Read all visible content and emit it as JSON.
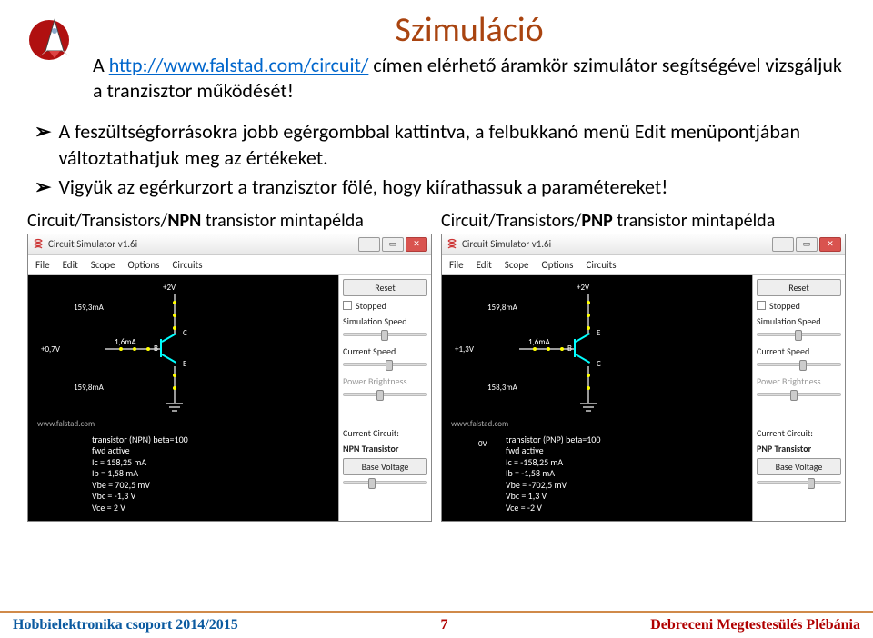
{
  "title": "Szimuláció",
  "intro_prefix": "A ",
  "intro_link": "http://www.falstad.com/circuit/",
  "intro_suffix": " címen elérhető áramkör szimulátor segítségével vizsgáljuk a tranzisztor működését!",
  "bullets": [
    "A feszültségforrásokra jobb egérgombbal kattintva, a felbukkanó menü Edit menüpontjában változtathatjuk meg az értékeket.",
    "Vigyük az egérkurzort a tranzisztor fölé, hogy kiírathassuk a paramétereket!"
  ],
  "sims": [
    {
      "caption_pre": "Circuit/Transistors/",
      "caption_bold": "NPN",
      "caption_post": " transistor mintapélda",
      "window_title": "Circuit Simulator v1.6i",
      "menu": [
        "File",
        "Edit",
        "Scope",
        "Options",
        "Circuits"
      ],
      "labels": {
        "top": "+2V",
        "left": "+0,7V",
        "i1": "159,3mA",
        "i2": "1,6mA",
        "i3": "159,8mA",
        "B": "B",
        "C": "C",
        "E": "E",
        "gnd": ""
      },
      "footer_url": "www.falstad.com",
      "text": [
        "transistor (NPN) beta=100",
        "fwd active",
        "Ic = 158,25 mA",
        "Ib = 1,58 mA",
        "Vbe = 702,5 mV",
        "Vbc = -1,3 V",
        "Vce = 2 V"
      ],
      "side": {
        "reset": "Reset",
        "stopped": "Stopped",
        "simspeed": "Simulation Speed",
        "curspeed": "Current Speed",
        "powerbright": "Power Brightness",
        "curcirc_lbl": "Current Circuit:",
        "curcirc": "NPN Transistor",
        "basevolt": "Base Voltage"
      }
    },
    {
      "caption_pre": "Circuit/Transistors/",
      "caption_bold": "PNP",
      "caption_post": " transistor mintapélda",
      "window_title": "Circuit Simulator v1.6i",
      "menu": [
        "File",
        "Edit",
        "Scope",
        "Options",
        "Circuits"
      ],
      "labels": {
        "top": "+2V",
        "left": "+1,3V",
        "i1": "159,8mA",
        "i2": "1,6mA",
        "i3": "158,3mA",
        "B": "B",
        "C": "C",
        "E": "E",
        "gnd": "0V"
      },
      "footer_url": "www.falstad.com",
      "text": [
        "transistor (PNP) beta=100",
        "fwd active",
        "Ic = -158,25 mA",
        "Ib = -1,58 mA",
        "Vbe = -702,5 mV",
        "Vbc = 1,3 V",
        "Vce = -2 V"
      ],
      "side": {
        "reset": "Reset",
        "stopped": "Stopped",
        "simspeed": "Simulation Speed",
        "curspeed": "Current Speed",
        "powerbright": "Power Brightness",
        "curcirc_lbl": "Current Circuit:",
        "curcirc": "PNP Transistor",
        "basevolt": "Base Voltage"
      }
    }
  ],
  "footer": {
    "left": "Hobbielektronika csoport 2014/2015",
    "center": "7",
    "right": "Debreceni Megtestesülés Plébánia"
  }
}
